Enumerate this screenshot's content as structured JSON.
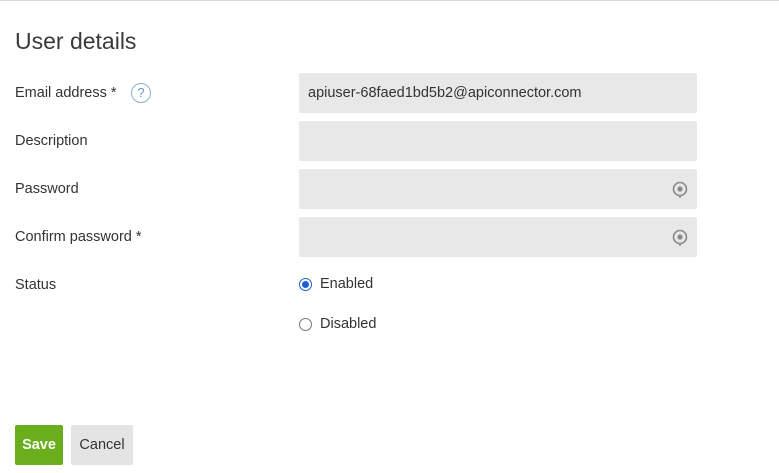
{
  "page": {
    "title": "User details"
  },
  "form": {
    "email": {
      "label": "Email address *",
      "help_icon": "question-mark-icon",
      "help_glyph": "?",
      "value": "apiuser-68faed1bd5b2@apiconnector.com"
    },
    "description": {
      "label": "Description",
      "value": ""
    },
    "password": {
      "label": "Password",
      "value": "",
      "icon": "password-reveal-icon"
    },
    "confirm_password": {
      "label": "Confirm password *",
      "value": "",
      "icon": "password-reveal-icon"
    },
    "status": {
      "label": "Status",
      "options": [
        {
          "label": "Enabled",
          "selected": true
        },
        {
          "label": "Disabled",
          "selected": false
        }
      ]
    }
  },
  "actions": {
    "save_label": "Save",
    "cancel_label": "Cancel"
  },
  "colors": {
    "save_button": "#6aae1c",
    "radio_selected": "#1a5fd0",
    "field_background": "#e8e8e8",
    "help_icon": "#6d96c7"
  }
}
